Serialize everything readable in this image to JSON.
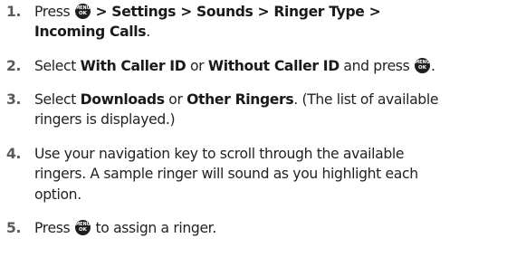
{
  "steps": [
    {
      "number": "1.",
      "press": "Press",
      "menu_path": "> Settings > Sounds > Ringer Type >",
      "menu_path_end": "Incoming Calls",
      "end_punct": "."
    },
    {
      "number": "2.",
      "select": "Select",
      "option_a": "With Caller ID",
      "or": "or",
      "option_b": "Without Caller ID",
      "and_press": "and press",
      "end_punct": "."
    },
    {
      "number": "3.",
      "select": "Select",
      "option_a": "Downloads",
      "or": "or",
      "option_b": "Other Ringers",
      "note_line1": ". (The list of available",
      "note_line2": "ringers is displayed.)"
    },
    {
      "number": "4.",
      "line1": "Use your navigation key to scroll through the available",
      "line2": "ringers. A sample ringer will sound as you highlight each",
      "line3": "option."
    },
    {
      "number": "5.",
      "press": "Press",
      "rest": "to assign a ringer."
    }
  ],
  "menu_ok_key": {
    "icon": "menu-ok-key-icon",
    "top_label": "MENU",
    "bottom_label": "OK"
  }
}
